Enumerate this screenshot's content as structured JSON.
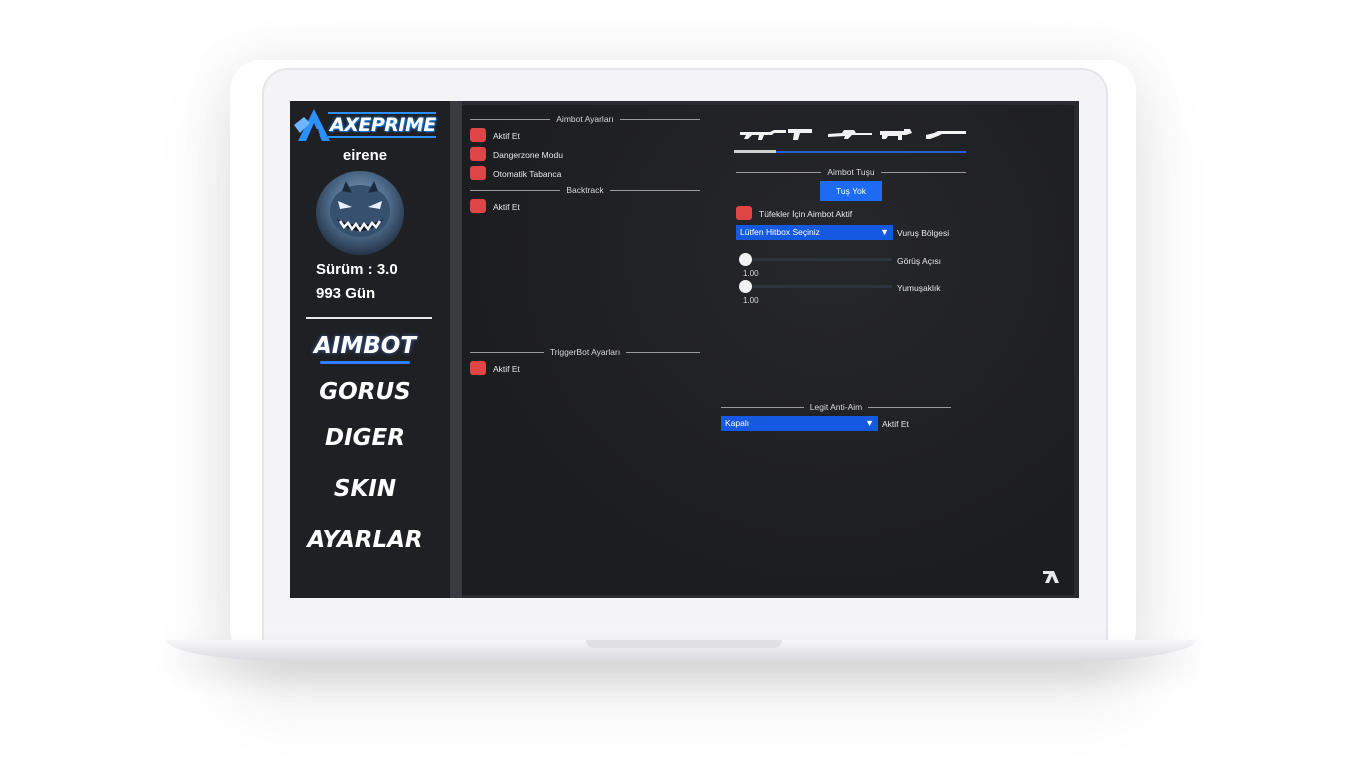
{
  "sidebar": {
    "logo_text": "AXEPRIME",
    "username": "eirene",
    "version": "Sürüm : 3.0",
    "days": "993 Gün",
    "nav": [
      {
        "label": "AIMBOT",
        "active": true
      },
      {
        "label": "GORUS",
        "active": false
      },
      {
        "label": "DIGER",
        "active": false
      },
      {
        "label": "SKIN",
        "active": false
      },
      {
        "label": "AYARLAR",
        "active": false
      }
    ]
  },
  "aimbot_settings": {
    "title": "Aimbot Ayarları",
    "items": [
      "Aktif Et",
      "Dangerzone Modu",
      "Otomatik Tabanca"
    ]
  },
  "backtrack": {
    "title": "Backtrack",
    "items": [
      "Aktif Et"
    ]
  },
  "triggerbot": {
    "title": "TriggerBot Ayarları",
    "items": [
      "Aktif Et"
    ]
  },
  "weapon_tabs": {
    "icons": [
      "rifle-icon",
      "pistol-icon",
      "sniper-icon",
      "smg-icon",
      "shotgun-icon"
    ],
    "active_index": 0
  },
  "aimbot_key": {
    "title": "Aimbot Tuşu",
    "button_label": "Tuş Yok"
  },
  "rifle_aimbot": {
    "label": "Tüfekler İçin Aimbot Aktif"
  },
  "hitbox": {
    "selected": "Lütfen Hitbox Seçiniz",
    "label": "Vuruş Bölgesi"
  },
  "sliders": [
    {
      "label": "Görüş Açısı",
      "value": "1.00",
      "fraction": 0.0
    },
    {
      "label": "Yumuşaklık",
      "value": "1.00",
      "fraction": 0.0
    }
  ],
  "anti_aim": {
    "title": "Legit Anti-Aim",
    "selected": "Kapalı",
    "label": "Aktif Et"
  },
  "colors": {
    "accent": "#1c6bf2",
    "checkbox": "#e04545",
    "background": "#1c1d20"
  }
}
